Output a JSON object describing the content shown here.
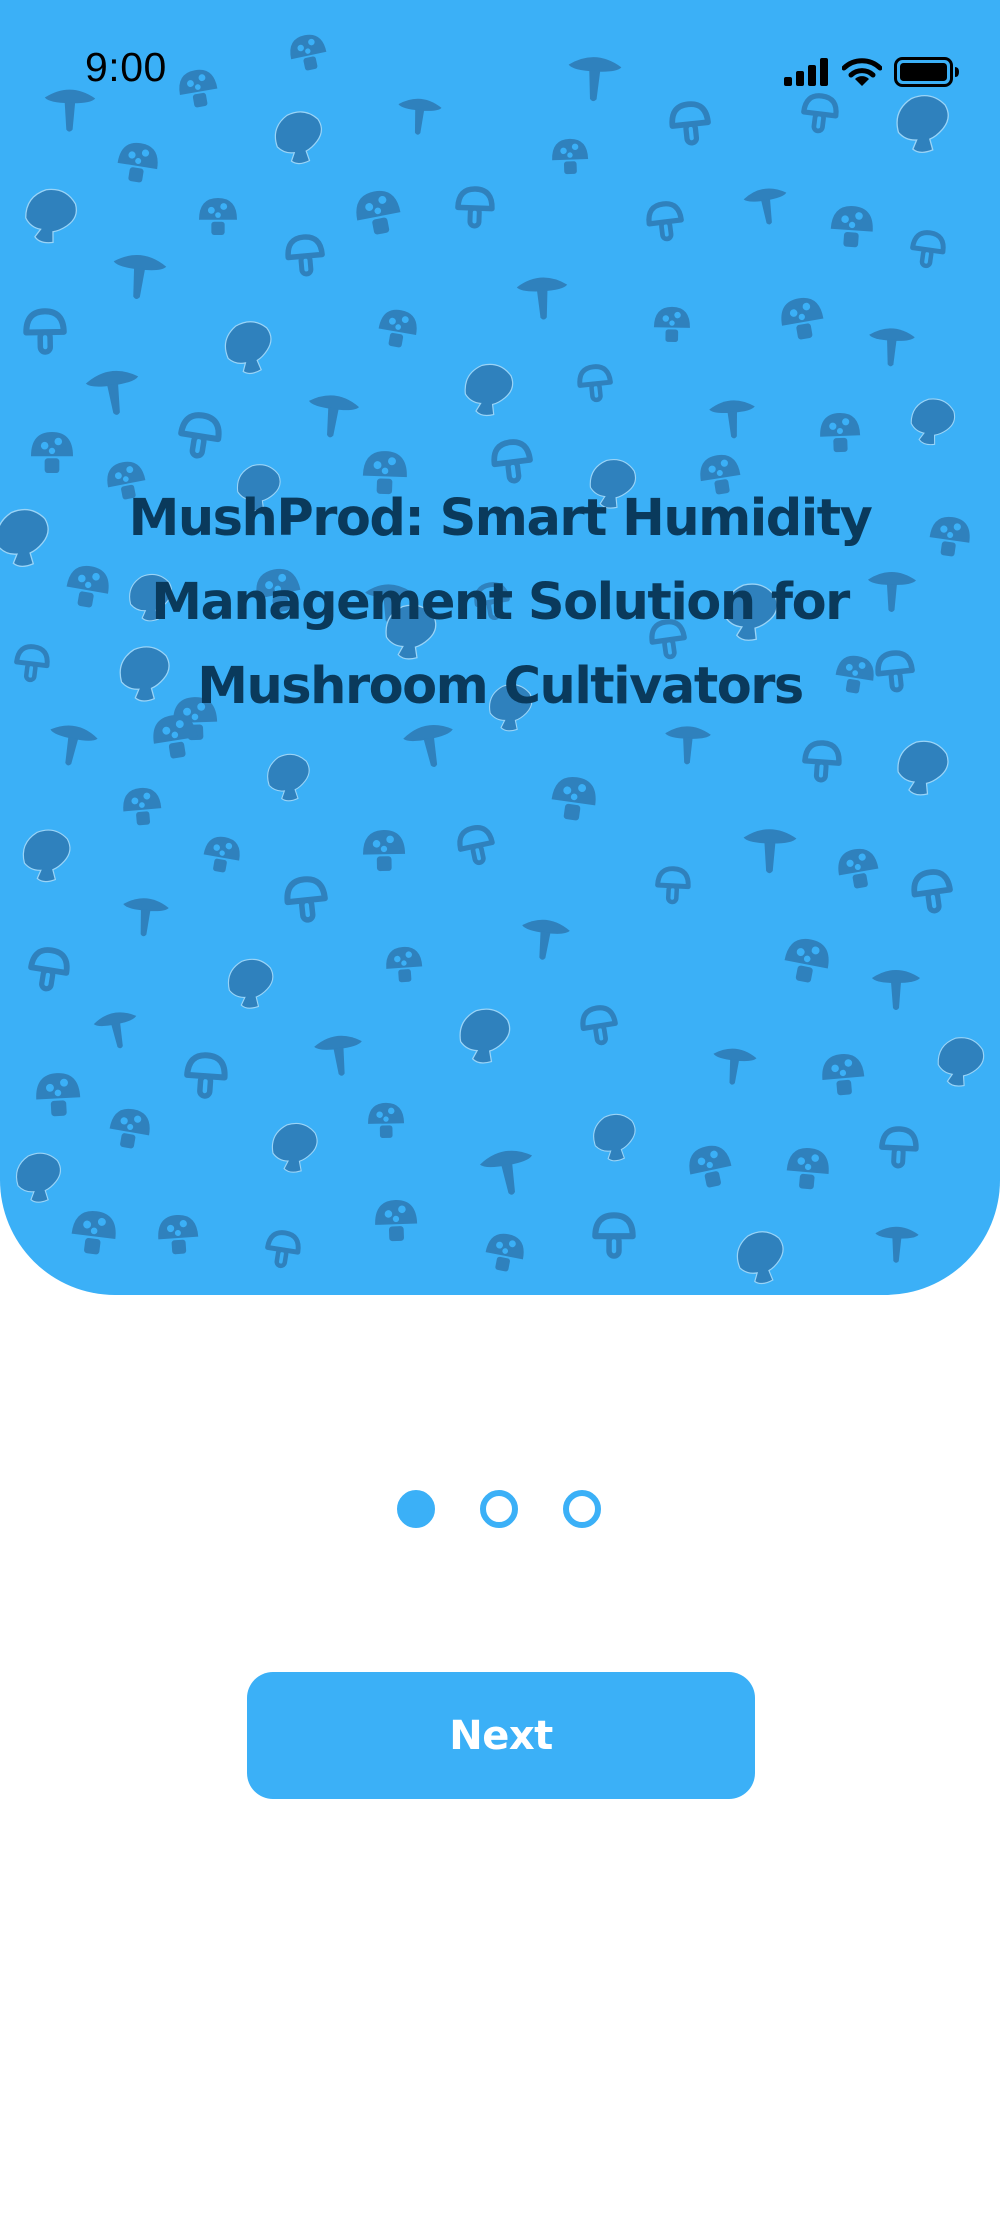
{
  "status_bar": {
    "time": "9:00",
    "icons": [
      "cellular-signal-icon",
      "wifi-icon",
      "battery-icon"
    ]
  },
  "hero": {
    "background_color": "#3bb0f7",
    "pattern_icon": "mushroom-icon",
    "pattern_color": "#2f81bd",
    "title": "MushProd: Smart Humidity Management Solution for Mushroom Cultivators",
    "title_color": "#0a3a5c"
  },
  "pagination": {
    "total": 3,
    "active_index": 0
  },
  "next_button": {
    "label": "Next"
  }
}
